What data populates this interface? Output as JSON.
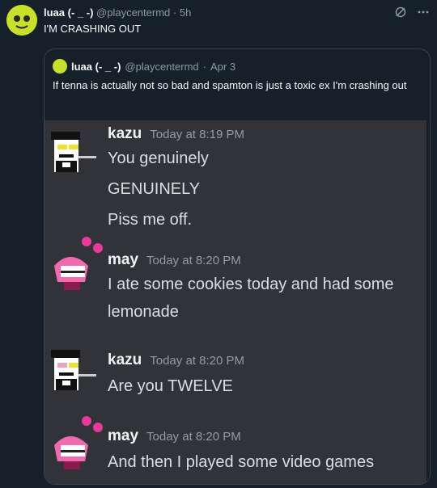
{
  "post": {
    "display_name": "luaa (- _ -)",
    "handle": "@playcentermd",
    "separator": "·",
    "time": "5h",
    "text": "I'M CRASHING OUT"
  },
  "quote": {
    "display_name": "luaa (- _ -)",
    "handle": "@playcentermd",
    "separator": "·",
    "time": "Apr 3",
    "text": "If tenna is actually not so bad and spamton is just a toxic ex I'm crashing out"
  },
  "chat": {
    "messages": [
      {
        "author": "kazu",
        "timestamp": "Today at 8:19 PM",
        "lines": [
          "You genuinely",
          "GENUINELY",
          "Piss me off."
        ]
      },
      {
        "author": "may",
        "timestamp": "Today at 8:20 PM",
        "lines": [
          "I ate some cookies today and had some",
          "lemonade"
        ]
      },
      {
        "author": "kazu",
        "timestamp": "Today at 8:20 PM",
        "lines": [
          "Are you TWELVE"
        ]
      },
      {
        "author": "may",
        "timestamp": "Today at 8:20 PM",
        "lines": [
          "And then I played some video games"
        ]
      }
    ]
  },
  "icons": {
    "grok": "grok-icon",
    "more": "more-icon"
  },
  "colors": {
    "background": "#15202b",
    "avatar_bg": "#c8e02a",
    "chat_bg": "#313338",
    "muted": "#8b98a5"
  }
}
